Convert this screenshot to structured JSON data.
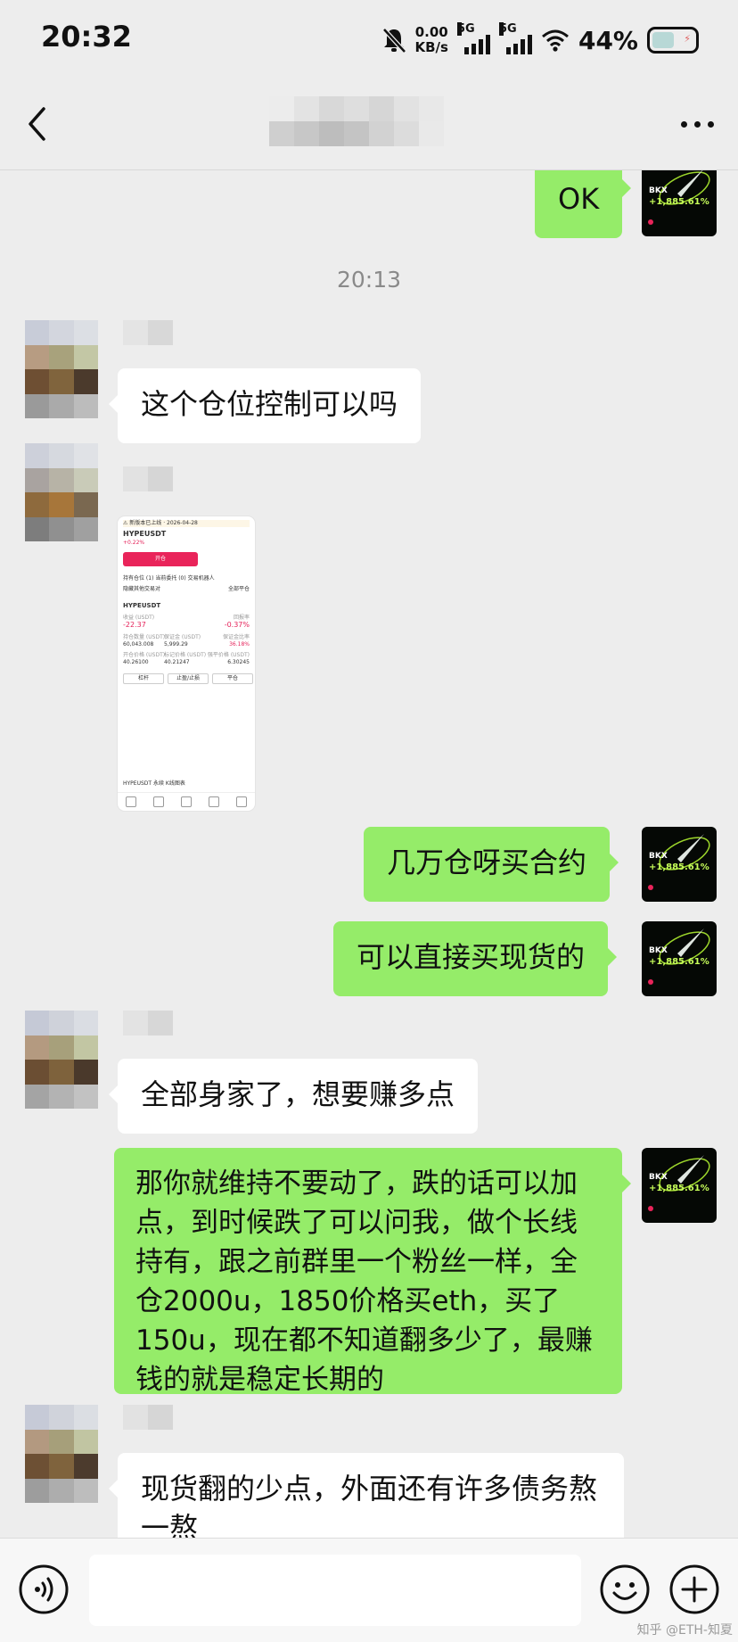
{
  "status_bar": {
    "time": "20:32",
    "net_speed_value": "0.00",
    "net_speed_unit": "KB/s",
    "sim1": "5G",
    "sim2": "5G",
    "battery": "44%",
    "mute_icon": "bell-off-icon",
    "wifi_icon": "wifi-icon"
  },
  "header": {
    "back_icon": "chevron-left-icon",
    "more_icon": "more-dots-icon"
  },
  "colors": {
    "background": "#ededed",
    "outgoing_bubble": "#95ec69",
    "incoming_bubble": "#ffffff",
    "timestamp_text": "#8a8a8a",
    "accent_pink": "#e9245a"
  },
  "self_avatar": {
    "brand": "BKX",
    "gain": "+1,885.61%"
  },
  "messages": [
    {
      "direction": "out",
      "type": "text",
      "text": "OK"
    },
    {
      "type": "timestamp",
      "text": "20:13"
    },
    {
      "direction": "in",
      "type": "text",
      "text": "这个仓位控制可以吗"
    },
    {
      "direction": "in",
      "type": "image",
      "image": {
        "header": "⚠ 新版本已上线 · 2026-04-28",
        "symbol": "HYPEUSDT",
        "change": "+0.22%",
        "open_button": "开仓",
        "tabs": "持有仓位 (1)   当前委托 (0)   交易机器人",
        "hide_label": "隐藏其他交易对",
        "close_all": "全部平仓",
        "position_name": "HYPEUSDT",
        "pnl_label": "收益 (USDT)",
        "pnl_value": "-22.37",
        "roe_label": "回报率",
        "roe_value": "-0.37%",
        "size_label": "持仓数量 (USDT)",
        "size_value": "60,043.008",
        "margin_label": "保证金 (USDT)",
        "margin_value": "5,999.29",
        "ratio_label": "保证金比率",
        "ratio_value": "36.18%",
        "entry_label": "开仓价格 (USDT)",
        "entry_value": "40.26100",
        "mark_label": "标记价格 (USDT)",
        "mark_value": "40.21247",
        "liq_label": "强平价格 (USDT)",
        "liq_value": "6.30245",
        "btn_leverage": "杠杆",
        "btn_tpsl": "止盈/止损",
        "btn_close": "平仓",
        "footer": "HYPEUSDT 永续 K线图表"
      }
    },
    {
      "direction": "out",
      "type": "text",
      "text": "几万仓呀买合约"
    },
    {
      "direction": "out",
      "type": "text",
      "text": "可以直接买现货的"
    },
    {
      "direction": "in",
      "type": "text",
      "text": "全部身家了，想要赚多点"
    },
    {
      "direction": "out",
      "type": "text",
      "text": "那你就维持不要动了，跌的话可以加点，到时候跌了可以问我，做个长线持有，跟之前群里一个粉丝一样，全仓2000u，1850价格买eth，买了150u，现在都不知道翻多少了，最赚钱的就是稳定长期的"
    },
    {
      "direction": "in",
      "type": "text",
      "text": "现货翻的少点，外面还有许多债务熬一熬"
    }
  ],
  "input_bar": {
    "voice_icon": "voice-icon",
    "input_value": "",
    "emoji_icon": "emoji-icon",
    "plus_icon": "plus-circle-icon"
  },
  "watermark": "知乎 @ETH-知夏"
}
